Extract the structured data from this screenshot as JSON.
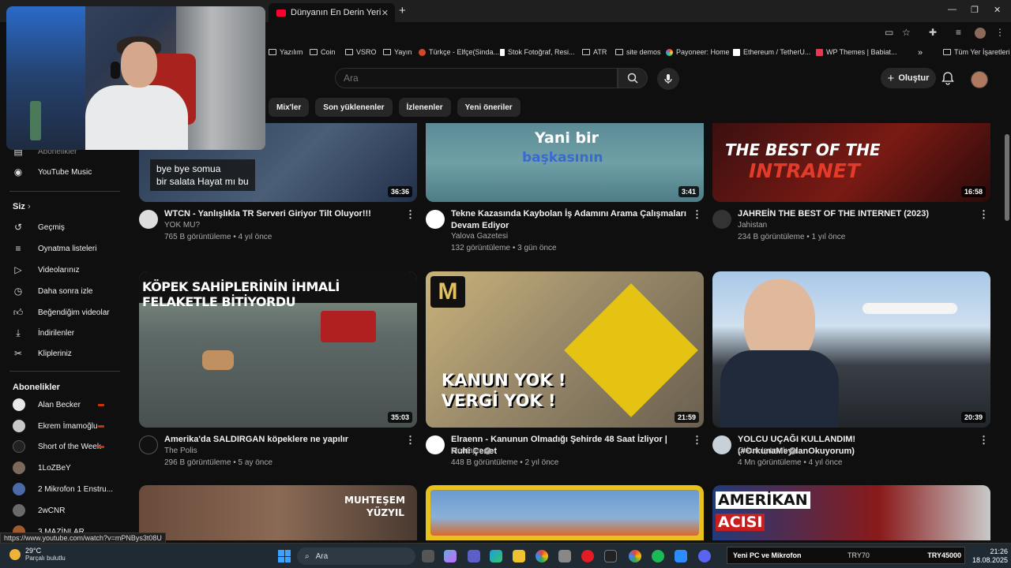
{
  "browser": {
    "active_tab_title": "Dünyanın En Derin Yerine İnmek",
    "bookmarks": [
      {
        "label": "Yazılım"
      },
      {
        "label": "Coin"
      },
      {
        "label": "VSRO"
      },
      {
        "label": "Yayın"
      },
      {
        "label": "Türkçe - Elfçe(Sinda..."
      },
      {
        "label": "Stok Fotoğraf, Resi..."
      },
      {
        "label": "ATR"
      },
      {
        "label": "site demos"
      },
      {
        "label": "Payoneer: Home"
      },
      {
        "label": "Ethereum / TetherU..."
      },
      {
        "label": "WP Themes | Babiat..."
      }
    ],
    "all_bookmarks": "Tüm Yer İşaretleri",
    "status_url": "https://www.youtube.com/watch?v=mPNBys3t08U"
  },
  "youtube": {
    "search_placeholder": "Ara",
    "create_label": "Oluştur",
    "chips": [
      "Mix'ler",
      "Son yüklenenler",
      "İzlenenler",
      "Yeni öneriler"
    ]
  },
  "sidebar": {
    "partial_item": "Abonelikler",
    "music": "YouTube Music",
    "you_heading": "Siz",
    "you_items": [
      {
        "label": "Geçmiş",
        "icon": "history-icon"
      },
      {
        "label": "Oynatma listeleri",
        "icon": "playlist-icon"
      },
      {
        "label": "Videolarınız",
        "icon": "your-videos-icon"
      },
      {
        "label": "Daha sonra izle",
        "icon": "watch-later-icon"
      },
      {
        "label": "Beğendiğim videolar",
        "icon": "like-icon"
      },
      {
        "label": "İndirilenler",
        "icon": "download-icon"
      },
      {
        "label": "Klipleriniz",
        "icon": "scissors-icon"
      }
    ],
    "subs_heading": "Abonelikler",
    "subscriptions": [
      {
        "label": "Alan Becker",
        "live": true
      },
      {
        "label": "Ekrem İmamoğlu",
        "live": true
      },
      {
        "label": "Short of the Week",
        "live": true
      },
      {
        "label": "1LoZBeY",
        "live": false
      },
      {
        "label": "2 Mikrofon 1 Enstru...",
        "live": false
      },
      {
        "label": "2wCNR",
        "live": false
      },
      {
        "label": "3 MAZİNLAR",
        "live": false
      }
    ]
  },
  "videos": [
    {
      "title": "WTCN - Yanlışlıkla TR Serveri Giriyor Tilt Oluyor!!!",
      "channel": "YOK MU?",
      "verified": false,
      "stats": "765 B görüntüleme • 4 yıl önce",
      "duration": "36:36",
      "thumb_text": "bye bye somua\nbir salata Hayat mı bu"
    },
    {
      "title": "Tekne Kazasında Kaybolan İş Adamını Arama Çalışmaları Devam Ediyor",
      "channel": "Yalova Gazetesi",
      "verified": false,
      "stats": "132 görüntüleme • 3 gün önce",
      "duration": "3:41",
      "thumb_text_1": "Yani bir",
      "thumb_text_2": "başkasının"
    },
    {
      "title": "JAHREİN THE BEST OF THE INTERNET (2023)",
      "channel": "Jahistan",
      "verified": false,
      "stats": "234 B görüntüleme • 1 yıl önce",
      "duration": "16:58",
      "thumb_text_1": "THE BEST OF THE",
      "thumb_text_2": "INTRANET"
    },
    {
      "title": "Amerika'da SALDIRGAN köpeklere ne yapılır",
      "channel": "The Polis",
      "verified": false,
      "stats": "296 B görüntüleme • 5 ay önce",
      "duration": "35:03",
      "thumb_text": "KÖPEK SAHİPLERİNİN İHMALİ FELAKETLE BİTİYORDU"
    },
    {
      "title": "Elraenn - Kanunun Olmadığı Şehirde 48 Saat İzliyor | Ruhi Çenet",
      "channel": "Montajer",
      "verified": true,
      "stats": "448 B görüntüleme • 2 yıl önce",
      "duration": "21:59",
      "thumb_text_1": "KANUN YOK !",
      "thumb_text_2": "VERGİ YOK !"
    },
    {
      "title": "YOLCU UÇAĞI KULLANDIM! (#OrkunaMeydanOkuyorum)",
      "channel": "Orkun Işıtmak",
      "verified": true,
      "stats": "4 Mn görüntüleme • 4 yıl önce",
      "duration": "20:39"
    },
    {
      "thumb_text_1": "MUHTEŞEM",
      "thumb_text_2": "YÜZYIL"
    },
    {},
    {
      "thumb_text_1": "AMERİKAN",
      "thumb_text_2": "ACISI"
    }
  ],
  "taskbar": {
    "temperature": "29°C",
    "weather": "Parçalı bulutlu",
    "search": "Ara",
    "ticker_title": "Yeni PC ve Mikrofon",
    "ticker_current": "TRY70",
    "ticker_goal": "TRY45000",
    "time": "21:26",
    "date": "18.08.2025"
  }
}
